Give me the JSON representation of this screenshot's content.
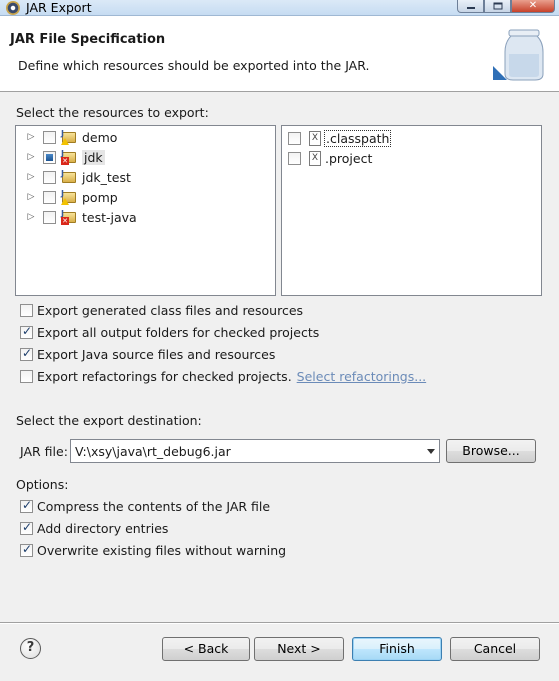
{
  "window": {
    "title": "JAR Export"
  },
  "header": {
    "title": "JAR File Specification",
    "description": "Define which resources should be exported into the JAR."
  },
  "resources": {
    "label": "Select the resources to export:",
    "projects": [
      {
        "name": "demo",
        "checked": false,
        "badge": "warning"
      },
      {
        "name": "jdk",
        "checked": "partial",
        "badge": "error",
        "selected": true
      },
      {
        "name": "jdk_test",
        "checked": false,
        "badge": "none"
      },
      {
        "name": "pomp",
        "checked": false,
        "badge": "warning"
      },
      {
        "name": "test-java",
        "checked": false,
        "badge": "error"
      }
    ],
    "files": [
      {
        "name": ".classpath",
        "checked": false,
        "focused": true
      },
      {
        "name": ".project",
        "checked": false
      }
    ]
  },
  "export_options": [
    {
      "label": "Export generated class files and resources",
      "checked": false
    },
    {
      "label": "Export all output folders for checked projects",
      "checked": true
    },
    {
      "label": "Export Java source files and resources",
      "checked": true
    },
    {
      "label": "Export refactorings for checked projects.",
      "checked": false,
      "link": "Select refactorings..."
    }
  ],
  "destination": {
    "label": "Select the export destination:",
    "jar_label": "JAR file:",
    "jar_value": "V:\\xsy\\java\\rt_debug6.jar",
    "browse": "Browse..."
  },
  "options": {
    "label": "Options:",
    "items": [
      {
        "label": "Compress the contents of the JAR file",
        "checked": true
      },
      {
        "label": "Add directory entries",
        "checked": true
      },
      {
        "label": "Overwrite existing files without warning",
        "checked": true
      }
    ]
  },
  "buttons": {
    "help": "?",
    "back": "< Back",
    "next": "Next >",
    "finish": "Finish",
    "cancel": "Cancel"
  },
  "colors": {
    "link": "#6b8bb8",
    "default_button_border": "#3c7fb1"
  }
}
